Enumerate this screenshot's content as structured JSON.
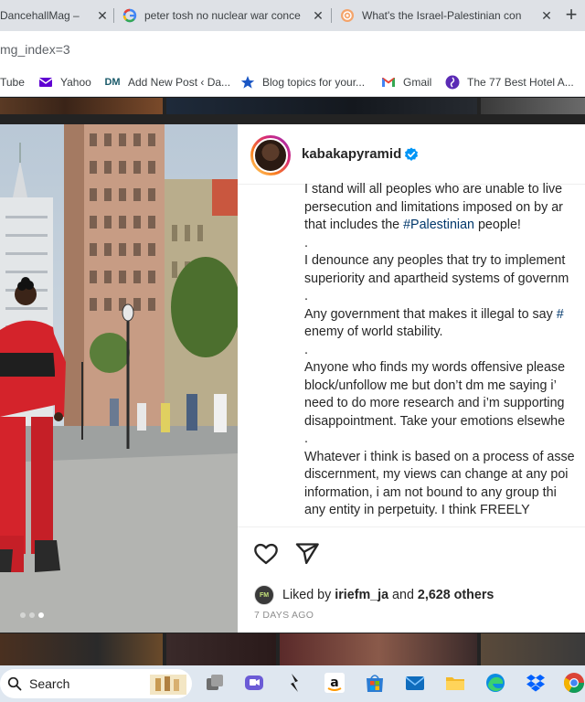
{
  "browser": {
    "tabs": [
      {
        "title": "DancehallMag –",
        "icon": "dancehallmag-favicon"
      },
      {
        "title": "peter tosh no nuclear war conce",
        "icon": "google-favicon"
      },
      {
        "title": "What's the Israel-Palestinian con",
        "icon": "web-favicon"
      }
    ],
    "url": "mg_index=3",
    "bookmarks": [
      {
        "label": "Tube",
        "icon": "youtube-icon"
      },
      {
        "label": "Yahoo",
        "icon": "yahoo-icon"
      },
      {
        "label": "Add New Post ‹ Da...",
        "icon": "dm-icon"
      },
      {
        "label": "Blog topics for your...",
        "icon": "star-icon"
      },
      {
        "label": "Gmail",
        "icon": "gmail-icon"
      },
      {
        "label": "The 77 Best Hotel A...",
        "icon": "web-icon"
      }
    ]
  },
  "post": {
    "username": "kabakapyramid",
    "caption_lines": [
      "I stand will all peoples who are unable to live",
      "persecution and limitations imposed on by ar",
      "that includes the #Palestinian people!",
      ".",
      "I denounce any peoples that try to implement",
      "superiority and apartheid systems of governm",
      ".",
      "Any government that makes it illegal to say #",
      "enemy of world stability.",
      ".",
      "Anyone who finds my words offensive please",
      "block/unfollow me but don’t dm me saying i’",
      "need to do more research and i’m supporting",
      "disappointment. Take your emotions elsewhe",
      ".",
      "Whatever i think is based on a process of asse",
      "discernment, my views can change at any poi",
      "information, i am not bound to any group thi",
      "any entity in perpetuity. I think FREELY"
    ],
    "caption_parts": {
      "l3_prefix": "that includes the ",
      "l3_hashtag": "#Palestinian",
      "l3_suffix": " people!",
      "l8_prefix": "Any government that makes it illegal to say ",
      "l8_hashtag": "#"
    },
    "liked_by_prefix": "Liked by",
    "liked_by_user": "iriefm_ja",
    "liked_by_and": "and",
    "liked_by_others": "2,628 others",
    "liker_avatar_text": "FM",
    "time_ago": "7 DAYS AGO",
    "carousel": {
      "count": 3,
      "active_index": 3
    }
  },
  "taskbar": {
    "search_label": "Search",
    "icons": [
      "widgets-icon",
      "task-view-icon",
      "chat-icon",
      "app-icon",
      "amazon-icon",
      "store-icon",
      "mail-icon",
      "file-explorer-icon",
      "edge-icon",
      "dropbox-icon",
      "chrome-icon"
    ]
  },
  "colors": {
    "hashtag": "#00376b",
    "verified": "#0095f6",
    "tabstrip": "#dee1e6",
    "taskbar": "#dfe7f0"
  }
}
